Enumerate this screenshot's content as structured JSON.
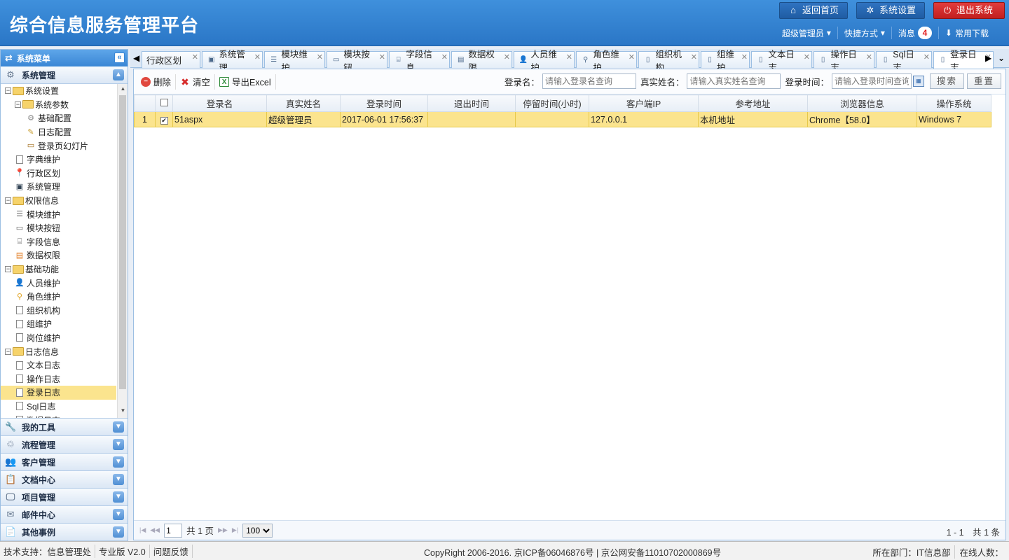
{
  "header": {
    "title": "综合信息服务管理平台",
    "btn_home": "返回首页",
    "btn_settings": "系统设置",
    "btn_logout": "退出系统",
    "user": "超级管理员",
    "shortcuts": "快捷方式",
    "messages_label": "消息",
    "messages_count": "4",
    "downloads": "常用下载"
  },
  "sidebar": {
    "title": "系统菜单",
    "collapse_icon": "«",
    "section_active": "系统管理",
    "tree": [
      {
        "label": "系统设置",
        "level": 0,
        "type": "folder"
      },
      {
        "label": "系统参数",
        "level": 1,
        "type": "folder"
      },
      {
        "label": "基础配置",
        "level": 2,
        "icon": "gear-icon"
      },
      {
        "label": "日志配置",
        "level": 2,
        "icon": "note-icon"
      },
      {
        "label": "登录页幻灯片",
        "level": 2,
        "icon": "slide-icon"
      },
      {
        "label": "字典维护",
        "level": 1,
        "icon": "page-icon"
      },
      {
        "label": "行政区划",
        "level": 1,
        "icon": "pin-icon"
      },
      {
        "label": "系统管理",
        "level": 1,
        "icon": "monitor-icon"
      },
      {
        "label": "权限信息",
        "level": 0,
        "type": "folder"
      },
      {
        "label": "模块维护",
        "level": 1,
        "icon": "module-icon"
      },
      {
        "label": "模块按钮",
        "level": 1,
        "icon": "button-icon"
      },
      {
        "label": "字段信息",
        "level": 1,
        "icon": "field-icon"
      },
      {
        "label": "数据权限",
        "level": 1,
        "icon": "data-icon"
      },
      {
        "label": "基础功能",
        "level": 0,
        "type": "folder"
      },
      {
        "label": "人员维护",
        "level": 1,
        "icon": "user-icon"
      },
      {
        "label": "角色维护",
        "level": 1,
        "icon": "role-icon"
      },
      {
        "label": "组织机构",
        "level": 1,
        "icon": "page-icon"
      },
      {
        "label": "组维护",
        "level": 1,
        "icon": "page-icon"
      },
      {
        "label": "岗位维护",
        "level": 1,
        "icon": "page-icon"
      },
      {
        "label": "日志信息",
        "level": 0,
        "type": "folder"
      },
      {
        "label": "文本日志",
        "level": 1,
        "icon": "page-icon"
      },
      {
        "label": "操作日志",
        "level": 1,
        "icon": "page-icon"
      },
      {
        "label": "登录日志",
        "level": 1,
        "icon": "page-icon",
        "selected": true
      },
      {
        "label": "Sql日志",
        "level": 1,
        "icon": "page-icon"
      },
      {
        "label": "数据日志",
        "level": 1,
        "icon": "page-icon"
      }
    ],
    "sections": [
      "我的工具",
      "流程管理",
      "客户管理",
      "文档中心",
      "项目管理",
      "邮件中心",
      "其他事例"
    ]
  },
  "tabs": [
    "行政区划",
    "系统管理",
    "模块维护",
    "模块按钮",
    "字段信息",
    "数据权限",
    "人员维护",
    "角色维护",
    "组织机构",
    "组维护",
    "文本日志",
    "操作日志",
    "Sql日志",
    "登录日志"
  ],
  "toolbar": {
    "delete": "删除",
    "clear": "清空",
    "export": "导出Excel",
    "login_name_label": "登录名：",
    "login_name_placeholder": "请输入登录名查询",
    "real_name_label": "真实姓名：",
    "real_name_placeholder": "请输入真实姓名查询",
    "login_time_label": "登录时间：",
    "login_time_placeholder": "请输入登录时间查询",
    "search": "搜索",
    "reset": "重置"
  },
  "grid": {
    "columns": [
      "登录名",
      "真实姓名",
      "登录时间",
      "退出时间",
      "停留时间(小时)",
      "客户端IP",
      "参考地址",
      "浏览器信息",
      "操作系统"
    ],
    "rows": [
      {
        "num": "1",
        "checked": true,
        "cells": [
          "51aspx",
          "超级管理员",
          "2017-06-01 17:56:37",
          "",
          "",
          "127.0.0.1",
          "本机地址",
          "Chrome【58.0】",
          "Windows 7"
        ]
      }
    ]
  },
  "pager": {
    "page": "1",
    "total_pages": "共 1 页",
    "page_size": "100",
    "info": "1 - 1　共 1 条"
  },
  "footer": {
    "support": "技术支持：信息管理处",
    "version": "专业版 V2.0",
    "feedback": "问题反馈",
    "copyright": "CopyRight 2006-2016. 京ICP备06046876号 | 京公网安备11010702000869号",
    "dept": "所在部门：IT信息部",
    "online": "在线人数："
  }
}
